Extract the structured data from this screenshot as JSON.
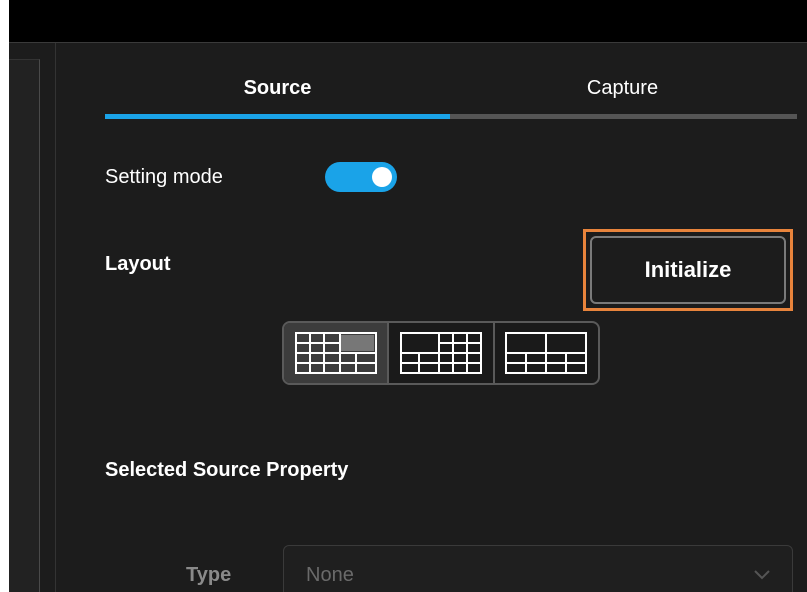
{
  "tabs": [
    {
      "label": "Source",
      "selected": true
    },
    {
      "label": "Capture",
      "selected": false
    }
  ],
  "setting_mode": {
    "label": "Setting mode",
    "enabled": true
  },
  "layout": {
    "label": "Layout",
    "initialize_label": "Initialize",
    "options": [
      {
        "name": "layout-option-1",
        "selected": true
      },
      {
        "name": "layout-option-2",
        "selected": false
      },
      {
        "name": "layout-option-3",
        "selected": false
      }
    ]
  },
  "selected_source": {
    "heading": "Selected Source Property",
    "type_label": "Type",
    "type_value": "None"
  },
  "colors": {
    "accent": "#1aa3e8",
    "highlight": "#e8843c",
    "background": "#1c1c1c"
  },
  "icons": [
    "grid-layout-icon",
    "chevron-down-icon"
  ]
}
